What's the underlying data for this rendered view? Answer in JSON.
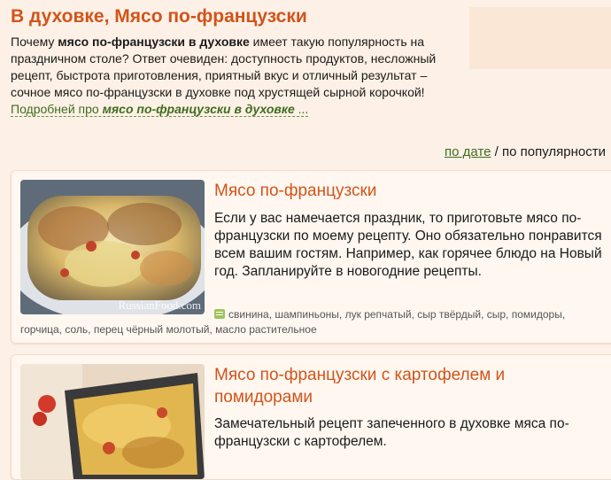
{
  "category": {
    "title": "В духовке, Мясо по-французски",
    "desc_1": "Почему ",
    "desc_bold": "мясо по-французски в духовке",
    "desc_2": " имеет такую популярность на праздничном столе? Ответ очевиден: доступность продуктов, несложный рецепт, быстрота приготовления, приятный вкус и отличный результат – сочное мясо по-французски в духовке под хрустящей сырной корочкой!",
    "more_prefix": "Подробней про ",
    "more_bold": "мясо по-французски в духовке",
    "more_suffix": " ..."
  },
  "sort": {
    "by_date": "по дате",
    "separator": " / ",
    "by_popularity": "по популярности"
  },
  "recipes": [
    {
      "title": "Мясо по-французски",
      "description": "Если у вас намечается праздник, то приготовьте мясо по-французски по моему рецепту. Оно обязательно понравится всем вашим гостям. Например, как горячее блюдо на Новый год. Запланируйте в новогодние рецепты.",
      "watermark": "RussianFood.com",
      "tags_line1": "свинина, шампиньоны, лук репчатый, сыр твёрдый, сыр, помидоры,",
      "tags_line2": "горчица, соль, перец чёрный молотый, масло растительное"
    },
    {
      "title": "Мясо по-французски с картофелем и помидорами",
      "description": "Замечательный рецепт запеченного в духовке мяса по-французски с картофелем."
    }
  ],
  "colors": {
    "background": "#fdf1e7",
    "title_orange": "#d1541a",
    "link_green": "#3f6d1d"
  }
}
